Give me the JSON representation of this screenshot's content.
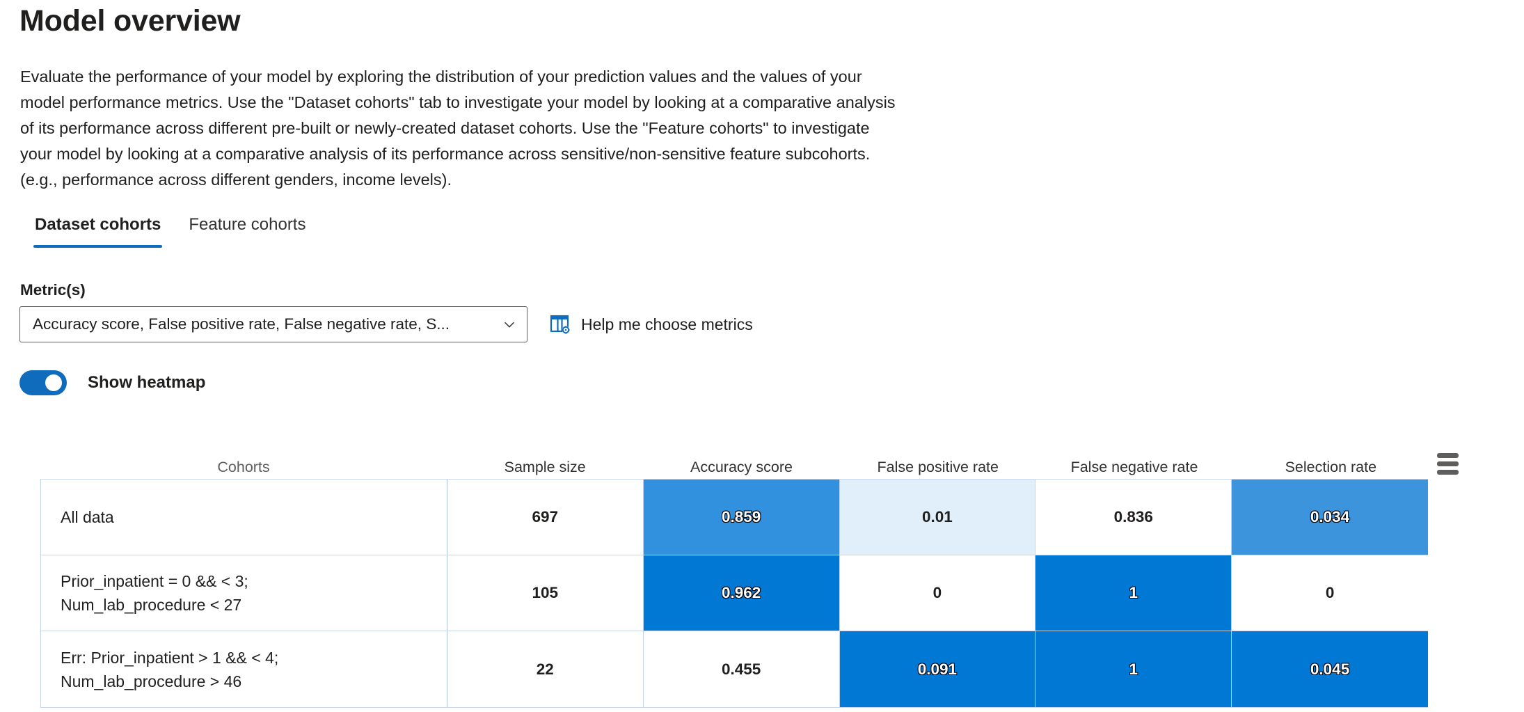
{
  "header": {
    "title": "Model overview",
    "description": "Evaluate the performance of your model by exploring the distribution of your prediction values and the values of your\nmodel performance metrics. Use the \"Dataset cohorts\" tab to investigate your model by looking at a comparative analysis\nof its performance across different pre-built or newly-created dataset cohorts. Use the \"Feature cohorts\" to investigate\nyour model by looking at a comparative analysis of its performance across sensitive/non-sensitive feature subcohorts.\n(e.g., performance across different genders, income levels)."
  },
  "tabs": [
    {
      "label": "Dataset cohorts",
      "active": true
    },
    {
      "label": "Feature cohorts",
      "active": false
    }
  ],
  "controls": {
    "metric_label": "Metric(s)",
    "metric_selected": "Accuracy score, False positive rate, False negative rate, S...",
    "metric_chevron_icon": "chevron-down-icon",
    "help_link_label": "Help me choose metrics",
    "help_link_icon": "table-settings-icon",
    "toggle_label": "Show heatmap",
    "toggle_on": true
  },
  "table": {
    "menu_icon": "hamburger-menu-icon",
    "columns": [
      "Cohorts",
      "Sample size",
      "Accuracy score",
      "False positive rate",
      "False negative rate",
      "Selection rate"
    ],
    "rows": [
      {
        "cohort": "All data",
        "cells": [
          {
            "value": "697",
            "fill": "#ffffff",
            "light_text": false
          },
          {
            "value": "0.859",
            "fill": "#3191de",
            "light_text": true
          },
          {
            "value": "0.01",
            "fill": "#e1effa",
            "light_text": false
          },
          {
            "value": "0.836",
            "fill": "#ffffff",
            "light_text": false
          },
          {
            "value": "0.034",
            "fill": "#3c94dd",
            "light_text": true
          }
        ]
      },
      {
        "cohort": "Prior_inpatient = 0 && < 3;\nNum_lab_procedure < 27",
        "cells": [
          {
            "value": "105",
            "fill": "#ffffff",
            "light_text": false
          },
          {
            "value": "0.962",
            "fill": "#0078d4",
            "light_text": true
          },
          {
            "value": "0",
            "fill": "#ffffff",
            "light_text": false
          },
          {
            "value": "1",
            "fill": "#0078d4",
            "light_text": true
          },
          {
            "value": "0",
            "fill": "#ffffff",
            "light_text": false
          }
        ]
      },
      {
        "cohort": "Err: Prior_inpatient > 1 && < 4;\nNum_lab_procedure > 46",
        "cells": [
          {
            "value": "22",
            "fill": "#ffffff",
            "light_text": false
          },
          {
            "value": "0.455",
            "fill": "#ffffff",
            "light_text": false
          },
          {
            "value": "0.091",
            "fill": "#0078d4",
            "light_text": true
          },
          {
            "value": "1",
            "fill": "#0078d4",
            "light_text": true
          },
          {
            "value": "0.045",
            "fill": "#0078d4",
            "light_text": true
          }
        ]
      }
    ]
  },
  "colors": {
    "accent": "#0f6cbd",
    "heatmap_max": "#0078d4",
    "heatmap_mid": "#3191de",
    "heatmap_low": "#e1effa",
    "grid_border": "#c7d6e8"
  }
}
